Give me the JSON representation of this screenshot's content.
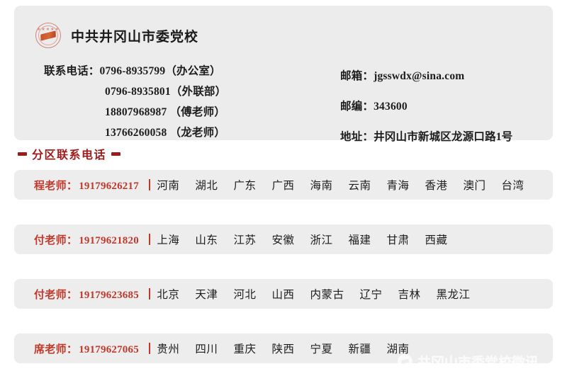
{
  "header": {
    "logo_icon": "red-seal-logo-icon",
    "org_title": "中共井冈山市委党校",
    "contact_left": [
      {
        "label": "联系电话：",
        "value": "0796-8935799（办公室）",
        "indented": false
      },
      {
        "label": "",
        "value": "0796-8935801（外联部）",
        "indented": true
      },
      {
        "label": "",
        "value": "18807968987 （傅老师）",
        "indented": true
      },
      {
        "label": "",
        "value": "13766260058 （龙老师）",
        "indented": true
      }
    ],
    "contact_right": [
      {
        "label": "邮箱：",
        "value": "jgsswdx@sina.com"
      },
      {
        "label": "邮编：",
        "value": "343600"
      },
      {
        "label": "地址：",
        "value": "井冈山市新城区龙源口路1号"
      }
    ]
  },
  "section": {
    "title": "分区联系电话",
    "accent_color": "#9e1b1b"
  },
  "contacts": [
    {
      "teacher": "程老师：",
      "phone": "19179626217",
      "regions": [
        "河南",
        "湖北",
        "广东",
        "广西",
        "海南",
        "云南",
        "青海",
        "香港",
        "澳门",
        "台湾"
      ]
    },
    {
      "teacher": "付老师：",
      "phone": "19179621820",
      "regions": [
        "上海",
        "山东",
        "江苏",
        "安徽",
        "浙江",
        "福建",
        "甘肃",
        "西藏"
      ]
    },
    {
      "teacher": "付老师：",
      "phone": "19179623685",
      "regions": [
        "北京",
        "天津",
        "河北",
        "山西",
        "内蒙古",
        "辽宁",
        "吉林",
        "黑龙江"
      ]
    },
    {
      "teacher": "席老师：",
      "phone": "19179627065",
      "regions": [
        "贵州",
        "四川",
        "重庆",
        "陕西",
        "宁夏",
        "新疆",
        "湖南"
      ]
    }
  ],
  "watermark": {
    "icon": "circular-logo-icon",
    "text": "井冈山市委党校微讯"
  }
}
